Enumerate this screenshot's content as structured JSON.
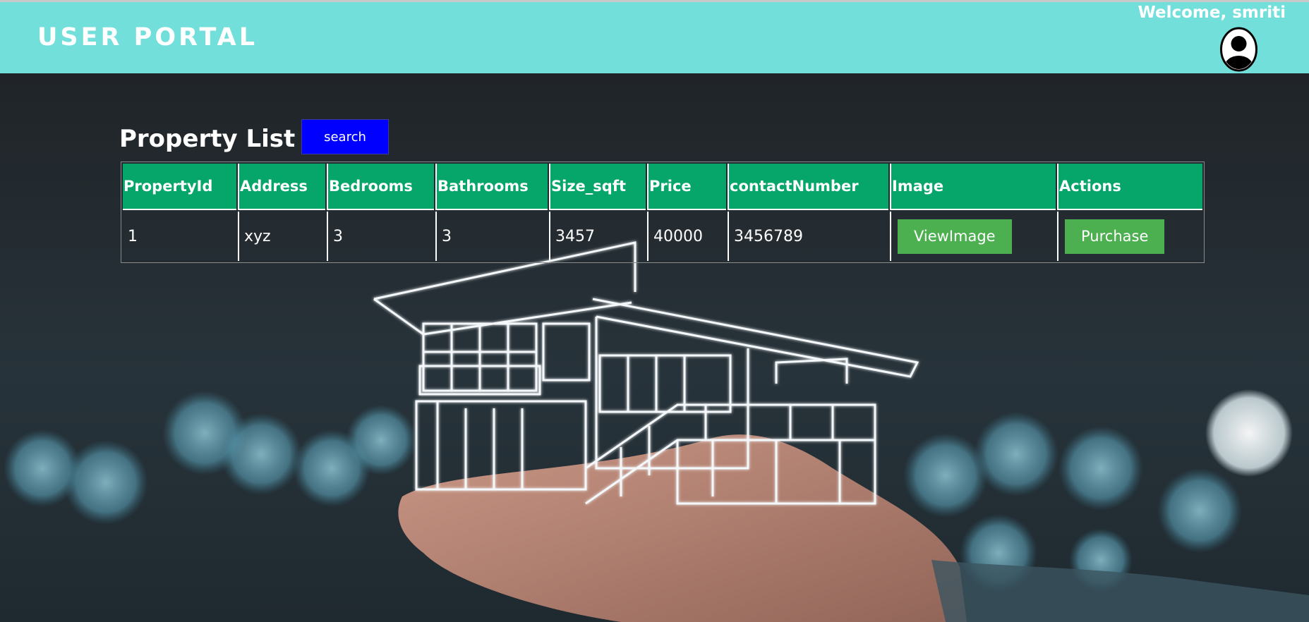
{
  "header": {
    "brand": "USER PORTAL",
    "welcome": "Welcome, smriti",
    "avatar_icon": "user-avatar-icon",
    "bg_color": "#72dfda"
  },
  "main": {
    "title": "Property List",
    "search_label": "search",
    "search_color": "#0000ff"
  },
  "table": {
    "header_color": "#06a66b",
    "columns": [
      "PropertyId",
      "Address",
      "Bedrooms",
      "Bathrooms",
      "Size_sqft",
      "Price",
      "contactNumber",
      "Image",
      "Actions"
    ],
    "rows": [
      {
        "propertyId": "1",
        "address": "xyz",
        "bedrooms": "3",
        "bathrooms": "3",
        "size_sqft": "3457",
        "price": "40000",
        "contactNumber": "3456789",
        "image_button": "ViewImage",
        "action_button": "Purchase"
      }
    ],
    "button_color": "#4caf50"
  },
  "background": {
    "description_icon": "house-on-hand-image"
  }
}
